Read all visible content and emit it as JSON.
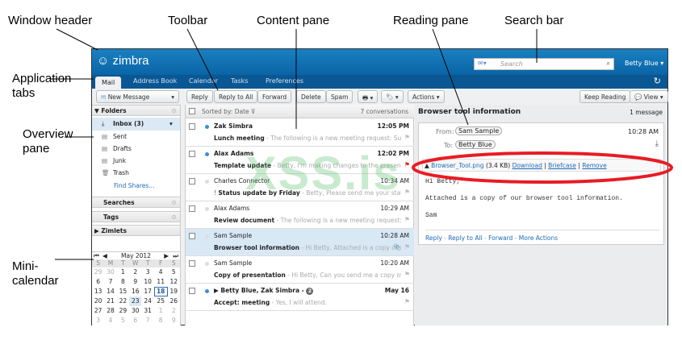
{
  "annotations": {
    "window_header": "Window header",
    "toolbar": "Toolbar",
    "content_pane": "Content pane",
    "reading_pane": "Reading pane",
    "search_bar": "Search bar",
    "application_tabs_1": "Application",
    "application_tabs_2": "tabs",
    "overview_pane_1": "Overview",
    "overview_pane_2": "pane",
    "mini_calendar_1": "Mini-",
    "mini_calendar_2": "calendar"
  },
  "watermark": "XSS.is",
  "header": {
    "logo": "zimbra",
    "search_placeholder": "Search",
    "user": "Betty Blue ▾"
  },
  "tabs": [
    "Mail",
    "Address Book",
    "Calendar",
    "Tasks",
    "Preferences"
  ],
  "toolbar": {
    "new_message": "New Message",
    "reply": "Reply",
    "reply_all": "Reply to All",
    "forward": "Forward",
    "delete": "Delete",
    "spam": "Spam",
    "print": "🖶 ▾",
    "tag": "🏷 ▾",
    "actions": "Actions ▾",
    "keep_reading": "Keep Reading",
    "view": "View ▾"
  },
  "overview": {
    "folders_header": "Folders",
    "folders": [
      {
        "label": "Inbox (3)",
        "icon": "inbox-icon"
      },
      {
        "label": "Sent",
        "icon": "sent-icon"
      },
      {
        "label": "Drafts",
        "icon": "drafts-icon"
      },
      {
        "label": "Junk",
        "icon": "junk-icon"
      },
      {
        "label": "Trash",
        "icon": "trash-icon"
      }
    ],
    "find_shares": "Find Shares...",
    "searches": "Searches",
    "tags": "Tags",
    "zimlets": "Zimlets"
  },
  "mini_calendar": {
    "month": "May 2012",
    "weekdays": [
      "S",
      "M",
      "T",
      "W",
      "T",
      "F",
      "S"
    ],
    "weeks": [
      [
        "29",
        "30",
        "1",
        "2",
        "3",
        "4",
        "5"
      ],
      [
        "6",
        "7",
        "8",
        "9",
        "10",
        "11",
        "12"
      ],
      [
        "13",
        "14",
        "15",
        "16",
        "17",
        "18",
        "19"
      ],
      [
        "20",
        "21",
        "22",
        "23",
        "24",
        "25",
        "26"
      ],
      [
        "27",
        "28",
        "29",
        "30",
        "31",
        "1",
        "2"
      ],
      [
        "3",
        "4",
        "5",
        "6",
        "7",
        "8",
        "9"
      ]
    ],
    "today": "18",
    "selected": "23"
  },
  "list": {
    "sort": "Sorted by: Date",
    "count": "7 conversations",
    "rows": [
      {
        "from": "Zak Simbra",
        "time": "12:05 PM",
        "subject": "Lunch meeting",
        "fragment": " - The following is a new meeting request: Subject: Lu",
        "unread": true
      },
      {
        "from": "Alax Adams",
        "time": "12:02 PM",
        "subject": "Template update",
        "fragment": " - Betty, I'm making changes to the presentation ten",
        "unread": true,
        "flagged": true
      },
      {
        "from": "Charles Connector",
        "time": "10:34 AM",
        "subject": "Status update by Friday",
        "fragment": " - Betty, Please send me your status update",
        "unread": false,
        "priority": true
      },
      {
        "from": "Alax Adams",
        "time": "10:29 AM",
        "subject": "Review document",
        "fragment": " - The following is a new meeting request: Subject:",
        "unread": false
      },
      {
        "from": "Sam Sample",
        "time": "10:28 AM",
        "subject": "Browser tool information",
        "fragment": " - Hi Betty, Attached is a copy of our bro",
        "unread": false,
        "selected": true,
        "attachment": true
      },
      {
        "from": "Sam Sample",
        "time": "10:20 AM",
        "subject": "Copy of presentation",
        "fragment": " - Hi Betty, Can you send me a copy of the prese",
        "unread": false
      },
      {
        "from": "▶ Betty Blue, Zak Simbra - ",
        "badge": "2",
        "time": "May 16",
        "subject": "Accept: meeting",
        "fragment": " - Yes, I will attend.",
        "unread": true
      }
    ]
  },
  "reading": {
    "title": "Browser tool information",
    "count": "1 message",
    "from_label": "From:",
    "from": "Sam Sample",
    "time": "10:28 AM",
    "to_label": "To:",
    "to": "Betty Blue",
    "attachment": {
      "name": "Browser_Tool.png",
      "size": "(3.4 KB)",
      "download": "Download",
      "briefcase": "Briefcase",
      "remove": "Remove"
    },
    "body": [
      "Hi Betty,",
      "Attached is a copy of our browser tool information.",
      "Sam"
    ],
    "actions": {
      "reply": "Reply",
      "reply_all": "Reply to All",
      "forward": "Forward",
      "more": "More Actions"
    }
  },
  "colors": {
    "header_blue": "#0a64a6",
    "highlight": "#e81c24"
  }
}
